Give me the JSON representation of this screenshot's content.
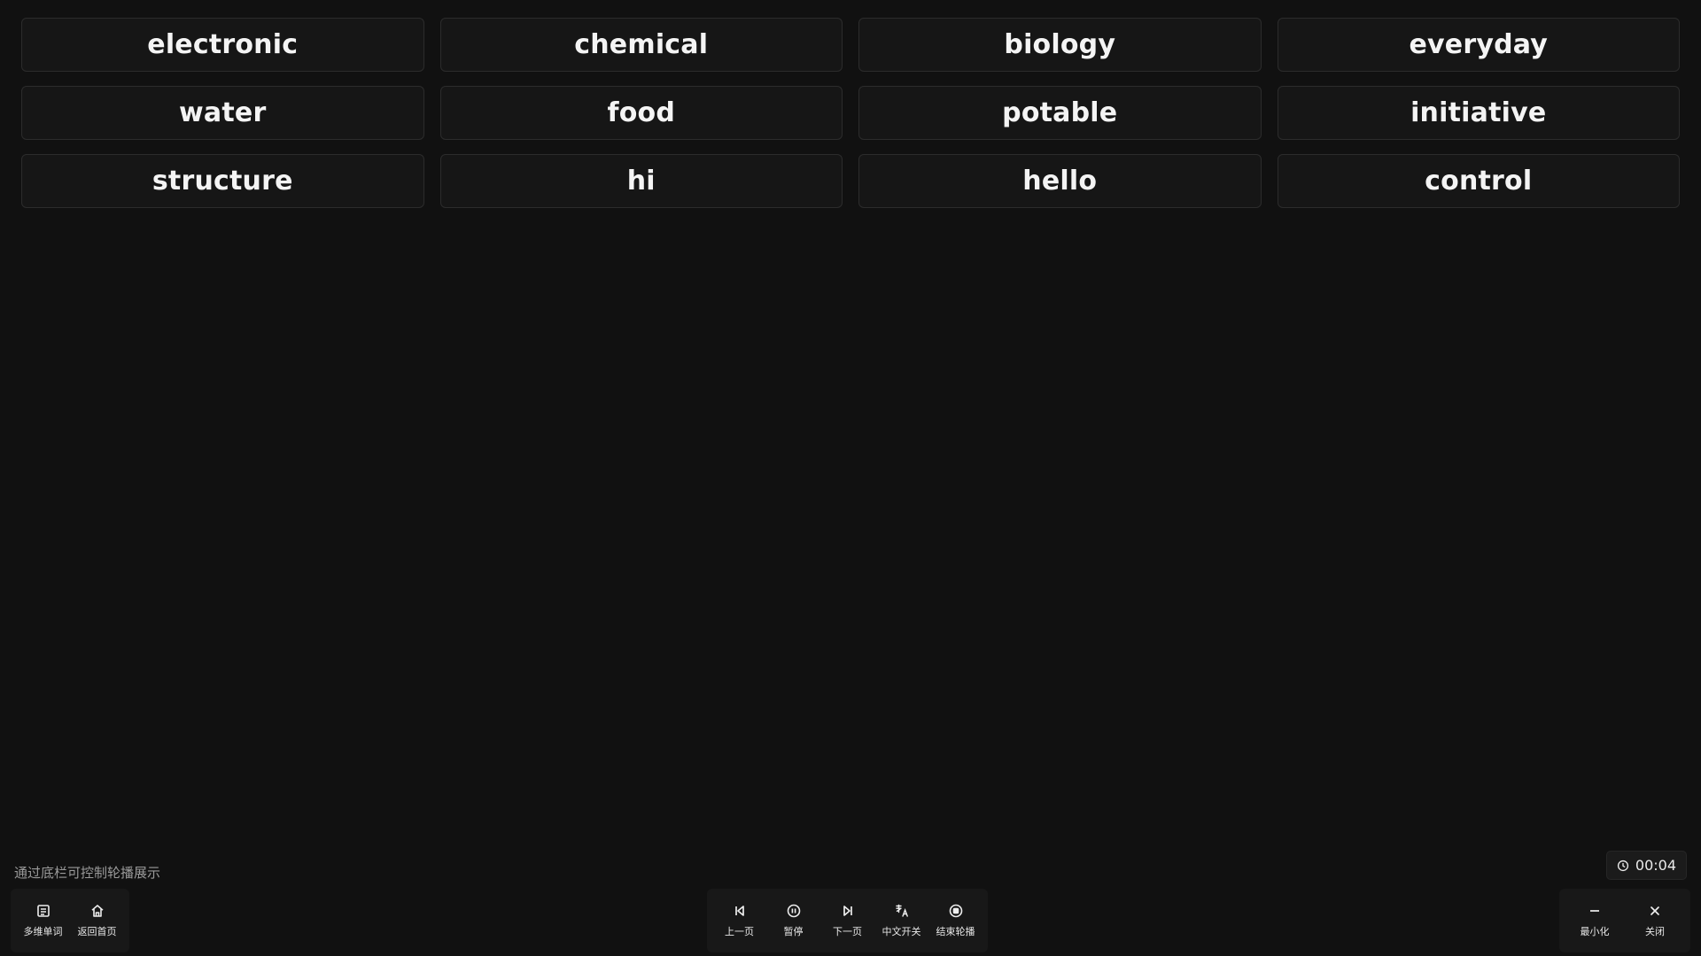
{
  "words": [
    "electronic",
    "chemical",
    "biology",
    "everyday",
    "water",
    "food",
    "potable",
    "initiative",
    "structure",
    "hi",
    "hello",
    "control"
  ],
  "hint": "通过底栏可控制轮播展示",
  "timer": {
    "icon": "clock-icon",
    "value": "00:04"
  },
  "toolbar": {
    "left": [
      {
        "icon": "word-list-icon",
        "label": "多维单词"
      },
      {
        "icon": "home-icon",
        "label": "返回首页"
      }
    ],
    "center": [
      {
        "icon": "previous-icon",
        "label": "上一页"
      },
      {
        "icon": "pause-icon",
        "label": "暂停"
      },
      {
        "icon": "next-icon",
        "label": "下一页"
      },
      {
        "icon": "translate-icon",
        "label": "中文开关"
      },
      {
        "icon": "stop-icon",
        "label": "结束轮播"
      }
    ],
    "right": [
      {
        "icon": "minimize-icon",
        "label": "最小化"
      },
      {
        "icon": "close-icon",
        "label": "关闭"
      }
    ]
  },
  "colors": {
    "background": "#111111",
    "card_background": "#161616",
    "card_border": "#2c2c2c",
    "text": "#f4f4f4",
    "muted_text": "#9a9a9a"
  }
}
